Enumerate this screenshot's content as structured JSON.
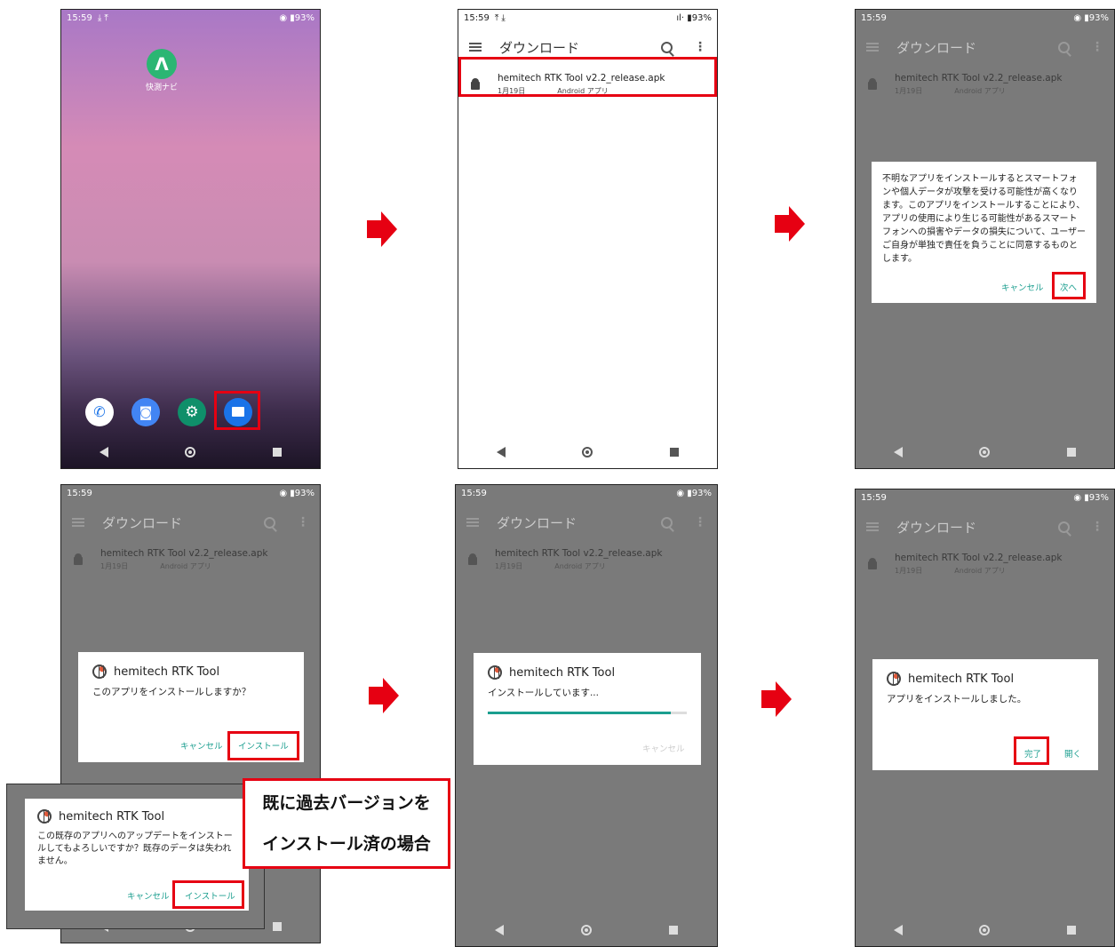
{
  "status": {
    "time": "15:59",
    "battery": "93%"
  },
  "home": {
    "shortcut_label": "快測ナビ"
  },
  "files": {
    "title": "ダウンロード",
    "menu_glyph": "⋮",
    "file_name": "hemitech RTK Tool v2.2_release.apk",
    "file_date": "1月19日",
    "file_type": "Android アプリ"
  },
  "warning_dialog": {
    "text": "不明なアプリをインストールするとスマートフォンや個人データが攻撃を受ける可能性が高くなります。このアプリをインストールすることにより、アプリの使用により生じる可能性があるスマートフォンへの損害やデータの損失について、ユーザーご自身が単独で責任を負うことに同意するものとします。",
    "cancel": "キャンセル",
    "next": "次へ"
  },
  "install_dialog": {
    "app_name": "hemitech RTK Tool",
    "question": "このアプリをインストールしますか？",
    "cancel": "キャンセル",
    "install": "インストール"
  },
  "update_dialog": {
    "app_name": "hemitech RTK Tool",
    "question": "この既存のアプリへのアップデートをインストールしてもよろしいですか？既存のデータは失われません。",
    "cancel": "キャンセル",
    "install": "インストール"
  },
  "callout": {
    "line1": "既に過去バージョンを",
    "line2": "インストール済の場合"
  },
  "progress_dialog": {
    "app_name": "hemitech RTK Tool",
    "message": "インストールしています...",
    "progress": 0.92,
    "cancel": "キャンセル"
  },
  "done_dialog": {
    "app_name": "hemitech RTK Tool",
    "message": "アプリをインストールしました。",
    "done": "完了",
    "open": "開く"
  },
  "colors": {
    "accent": "#1b9e8f",
    "highlight": "#e60012",
    "overlay": "#7a7a7a"
  }
}
